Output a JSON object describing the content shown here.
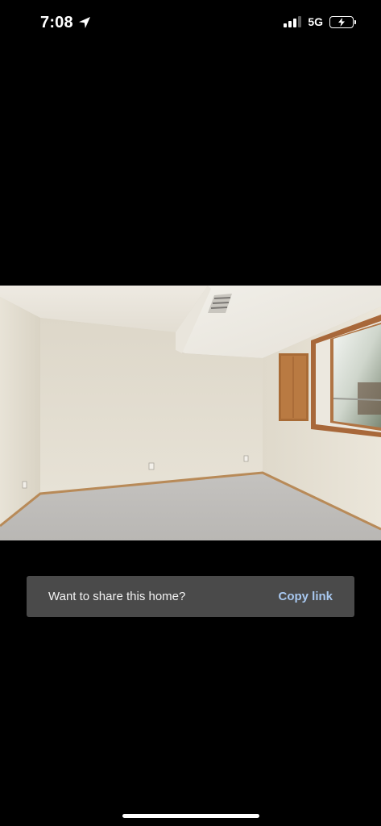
{
  "status_bar": {
    "time": "7:08",
    "network": "5G",
    "location_icon": "location-arrow-icon",
    "signal_icon": "cellular-signal-icon",
    "battery_icon": "battery-charging-icon"
  },
  "photo": {
    "description_icon": "listing-photo"
  },
  "share_toast": {
    "message": "Want to share this home?",
    "action_label": "Copy link",
    "action_color": "#a8c8f0",
    "background": "#4a4a4a"
  },
  "colors": {
    "background": "#000000",
    "text": "#ffffff"
  }
}
